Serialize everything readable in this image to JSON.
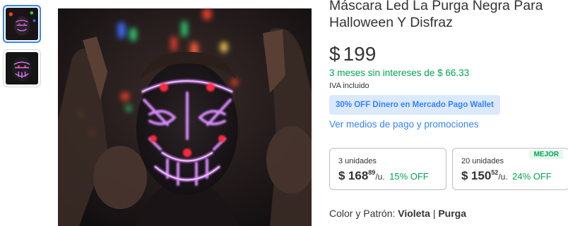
{
  "thumbnails": [
    {
      "name": "thumbnail-party-photo",
      "selected": true
    },
    {
      "name": "thumbnail-mask-product",
      "selected": false
    }
  ],
  "product": {
    "title_line1": "Máscara Led La Purga Negra Para",
    "title_line2": "Halloween Y Disfraz",
    "currency": "$",
    "price": "199",
    "installments": "3 meses sin intereses de $ 66.33",
    "tax_note": "IVA incluido",
    "promo_badge": "30% OFF Dinero en Mercado Pago Wallet",
    "payment_link": "Ver medios de pago y promociones"
  },
  "tiers": [
    {
      "quantity": "3 unidades",
      "currency": "$",
      "price": "168",
      "cents": "89",
      "unit": "/u.",
      "discount": "15% OFF",
      "badge": ""
    },
    {
      "quantity": "20 unidades",
      "currency": "$",
      "price": "150",
      "cents": "52",
      "unit": "/u.",
      "discount": "24% OFF",
      "badge": "MEJOR"
    }
  ],
  "variant": {
    "label": "Color y Patrón:",
    "color": "Violeta",
    "separator": "|",
    "pattern": "Purga"
  },
  "colors": {
    "accent": "#3483fa",
    "success": "#00a650",
    "mask_glow": "#c86bff"
  }
}
